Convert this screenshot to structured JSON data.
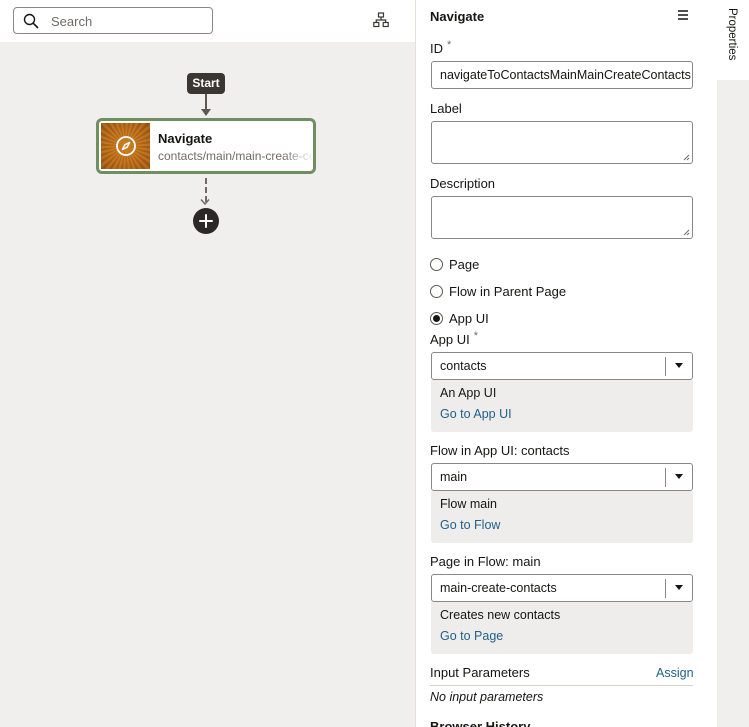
{
  "canvas": {
    "search_placeholder": "Search",
    "start_label": "Start",
    "node": {
      "title": "Navigate",
      "subtitle": "contacts/main/main-create-contacts"
    }
  },
  "panel": {
    "title": "Navigate",
    "id_label": "ID",
    "required_mark": "*",
    "id_value": "navigateToContactsMainMainCreateContacts",
    "label_label": "Label",
    "label_value": "",
    "description_label": "Description",
    "description_value": "",
    "radio_options": [
      {
        "label": "Page",
        "checked": false
      },
      {
        "label": "Flow in Parent Page",
        "checked": false
      },
      {
        "label": "App UI",
        "checked": true
      }
    ],
    "app_ui": {
      "label": "App UI",
      "value": "contacts",
      "info": "An App UI",
      "link": "Go to App UI"
    },
    "flow": {
      "label": "Flow in App UI: contacts",
      "value": "main",
      "info": "Flow main",
      "link": "Go to Flow"
    },
    "page": {
      "label": "Page in Flow: main",
      "value": "main-create-contacts",
      "info": "Creates new contacts",
      "link": "Go to Page"
    },
    "input_parameters": {
      "label": "Input Parameters",
      "assign": "Assign",
      "empty_note": "No input parameters"
    },
    "browser_history_label": "Browser History"
  },
  "side_tabs": {
    "properties": "Properties"
  },
  "colors": {
    "node_border": "#6f8f62",
    "link": "#20618c",
    "canvas_bg": "#f1efed",
    "dark_badge": "#3a3632"
  }
}
